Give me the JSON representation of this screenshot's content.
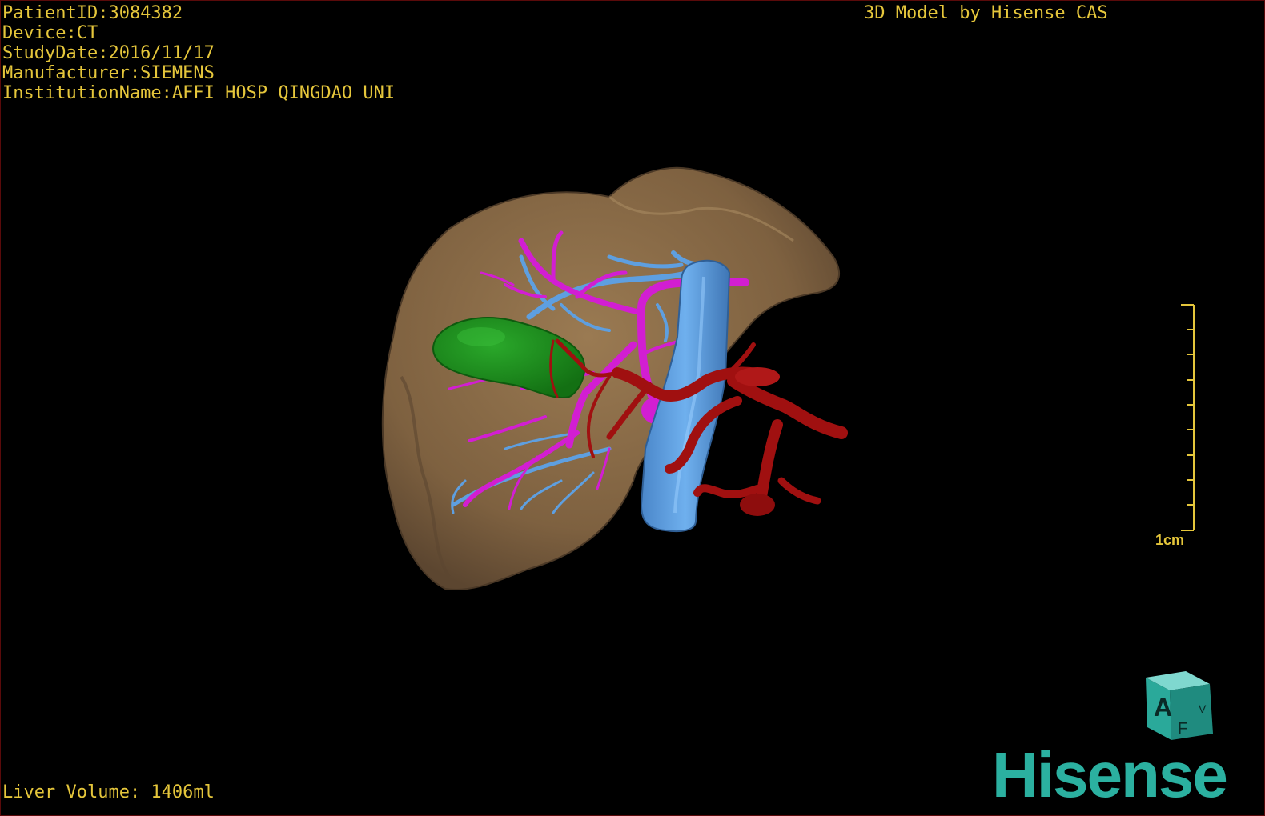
{
  "patient_info": {
    "patient_id": "PatientID:3084382",
    "device": "Device:CT",
    "study_date": "StudyDate:2016/11/17",
    "manufacturer": "Manufacturer:SIEMENS",
    "institution": "InstitutionName:AFFI HOSP QINGDAO UNI"
  },
  "header": {
    "model_credit": "3D Model by Hisense CAS"
  },
  "footer": {
    "liver_volume": "Liver Volume: 1406ml"
  },
  "scale_bar": {
    "label": "1cm"
  },
  "orientation_cube": {
    "front_label": "A",
    "bottom_label": "F",
    "side_label": "V"
  },
  "brand": {
    "logo_text": "Hisense"
  },
  "colors": {
    "overlay_text": "#e5c63b",
    "liver": "#8b6b47",
    "gallbladder": "#1a8c1a",
    "portal_vein": "#d21ed2",
    "hepatic_vein": "#5e9fe0",
    "artery": "#a01010",
    "brand": "#2bb0a0"
  }
}
